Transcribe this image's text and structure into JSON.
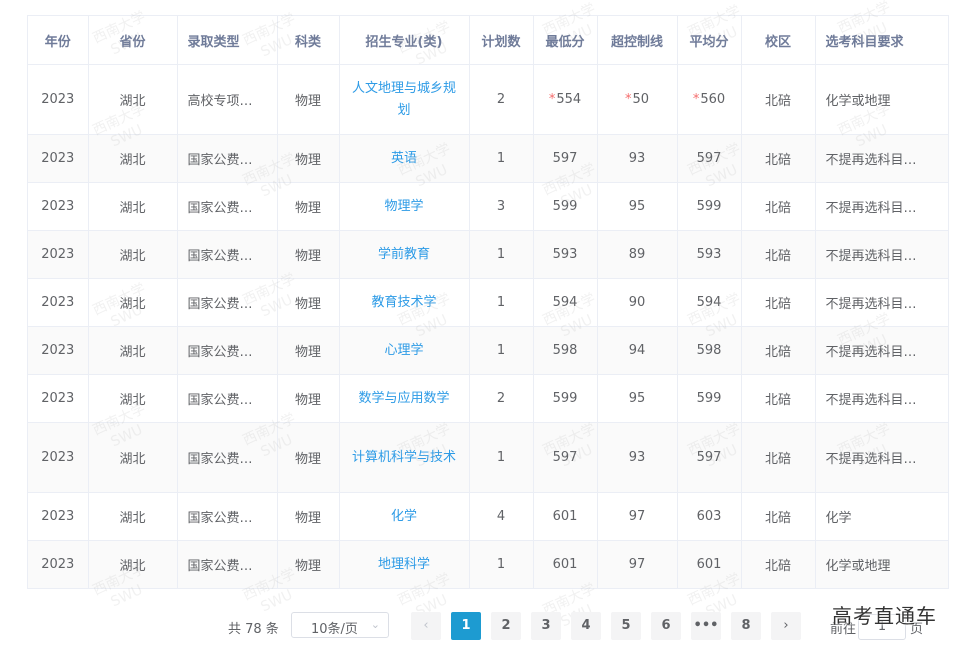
{
  "table": {
    "headers": [
      "年份",
      "省份",
      "录取类型",
      "科类",
      "招生专业(类)",
      "计划数",
      "最低分",
      "超控制线",
      "平均分",
      "校区",
      "选考科目要求"
    ],
    "rows": [
      {
        "year": "2023",
        "province": "湖北",
        "type": "高校专项…",
        "subject": "物理",
        "major": "人文地理与城乡规划",
        "plan": "2",
        "min": "554",
        "over": "50",
        "avg": "560",
        "campus": "北碚",
        "req": "化学或地理",
        "flagged": true,
        "tall": true
      },
      {
        "year": "2023",
        "province": "湖北",
        "type": "国家公费…",
        "subject": "物理",
        "major": "英语",
        "plan": "1",
        "min": "597",
        "over": "93",
        "avg": "597",
        "campus": "北碚",
        "req": "不提再选科目…",
        "flagged": false,
        "tall": false
      },
      {
        "year": "2023",
        "province": "湖北",
        "type": "国家公费…",
        "subject": "物理",
        "major": "物理学",
        "plan": "3",
        "min": "599",
        "over": "95",
        "avg": "599",
        "campus": "北碚",
        "req": "不提再选科目…",
        "flagged": false,
        "tall": false
      },
      {
        "year": "2023",
        "province": "湖北",
        "type": "国家公费…",
        "subject": "物理",
        "major": "学前教育",
        "plan": "1",
        "min": "593",
        "over": "89",
        "avg": "593",
        "campus": "北碚",
        "req": "不提再选科目…",
        "flagged": false,
        "tall": false
      },
      {
        "year": "2023",
        "province": "湖北",
        "type": "国家公费…",
        "subject": "物理",
        "major": "教育技术学",
        "plan": "1",
        "min": "594",
        "over": "90",
        "avg": "594",
        "campus": "北碚",
        "req": "不提再选科目…",
        "flagged": false,
        "tall": false
      },
      {
        "year": "2023",
        "province": "湖北",
        "type": "国家公费…",
        "subject": "物理",
        "major": "心理学",
        "plan": "1",
        "min": "598",
        "over": "94",
        "avg": "598",
        "campus": "北碚",
        "req": "不提再选科目…",
        "flagged": false,
        "tall": false
      },
      {
        "year": "2023",
        "province": "湖北",
        "type": "国家公费…",
        "subject": "物理",
        "major": "数学与应用数学",
        "plan": "2",
        "min": "599",
        "over": "95",
        "avg": "599",
        "campus": "北碚",
        "req": "不提再选科目…",
        "flagged": false,
        "tall": false
      },
      {
        "year": "2023",
        "province": "湖北",
        "type": "国家公费…",
        "subject": "物理",
        "major": "计算机科学与技术",
        "plan": "1",
        "min": "597",
        "over": "93",
        "avg": "597",
        "campus": "北碚",
        "req": "不提再选科目…",
        "flagged": false,
        "tall": true
      },
      {
        "year": "2023",
        "province": "湖北",
        "type": "国家公费…",
        "subject": "物理",
        "major": "化学",
        "plan": "4",
        "min": "601",
        "over": "97",
        "avg": "603",
        "campus": "北碚",
        "req": "化学",
        "flagged": false,
        "tall": false
      },
      {
        "year": "2023",
        "province": "湖北",
        "type": "国家公费…",
        "subject": "物理",
        "major": "地理科学",
        "plan": "1",
        "min": "601",
        "over": "97",
        "avg": "601",
        "campus": "北碚",
        "req": "化学或地理",
        "flagged": false,
        "tall": false
      }
    ]
  },
  "pagination": {
    "total_text": "共 78 条",
    "page_size": "10条/页",
    "prev_icon": "chevron-left-icon",
    "pages": [
      "1",
      "2",
      "3",
      "4",
      "5",
      "6",
      "•••",
      "8"
    ],
    "active_page": "1",
    "next_icon": "chevron-right-icon",
    "jump_prefix": "前往",
    "jump_value": "1",
    "jump_suffix": "页"
  },
  "watermark": {
    "line1": "西南大学",
    "line2": "SWU"
  },
  "brand_overlay": "高考直通车",
  "colors": {
    "accent": "#1d9bd1",
    "link": "#2d9be6",
    "flag": "#f56c6c",
    "header_text": "#6f7b99"
  }
}
